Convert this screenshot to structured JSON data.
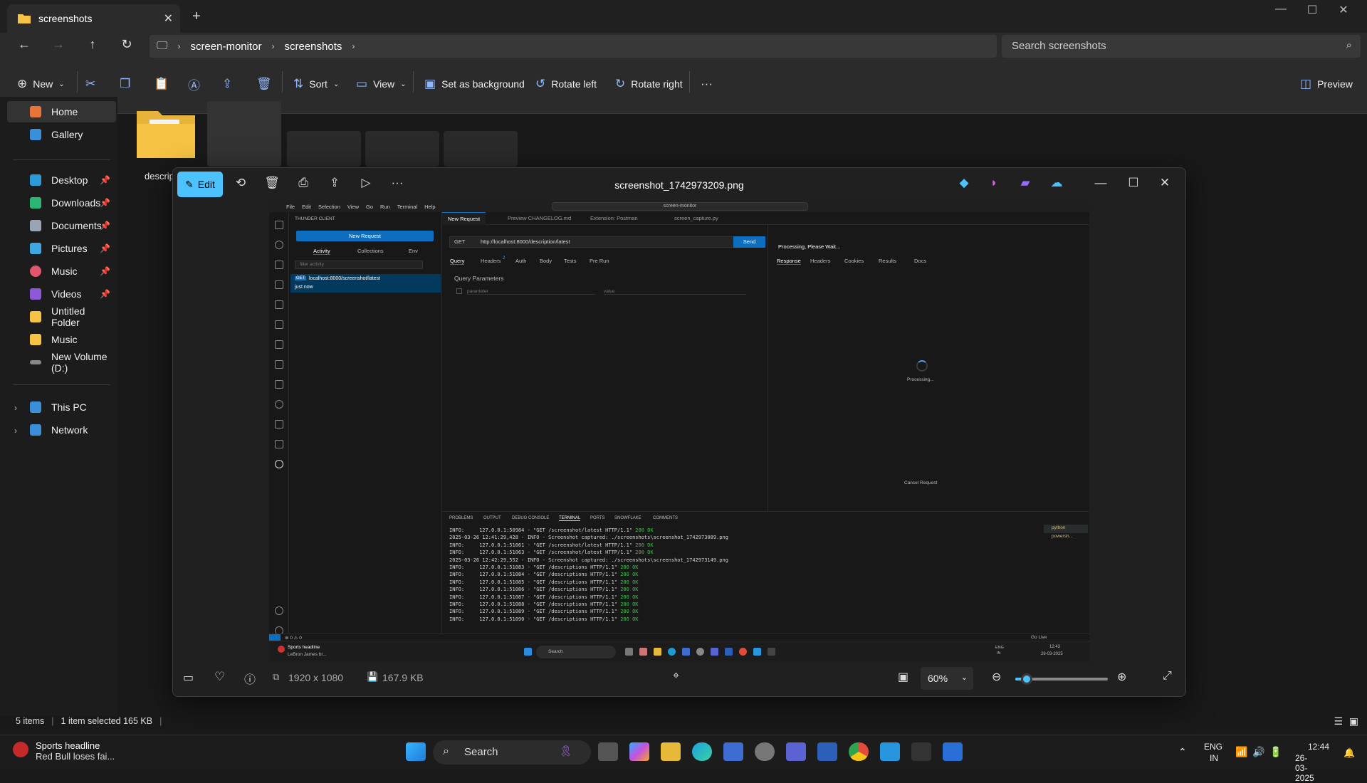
{
  "explorer": {
    "tab_title": "screenshots",
    "address": {
      "crumbs": [
        "screen-monitor",
        "screenshots"
      ]
    },
    "search_placeholder": "Search screenshots",
    "toolbar": {
      "new": "New",
      "sort": "Sort",
      "view": "View",
      "set_bg": "Set as background",
      "rotate_left": "Rotate left",
      "rotate_right": "Rotate right",
      "preview": "Preview"
    },
    "nav": {
      "home": "Home",
      "gallery": "Gallery",
      "desktop": "Desktop",
      "downloads": "Downloads",
      "documents": "Documents",
      "pictures": "Pictures",
      "music": "Music",
      "videos": "Videos",
      "untitled": "Untitled Folder",
      "music2": "Music",
      "volume": "New Volume (D:)",
      "thispc": "This PC",
      "network": "Network"
    },
    "folder_label": "descrip",
    "status": {
      "items": "5 items",
      "selected": "1 item selected  165 KB"
    }
  },
  "photos": {
    "edit": "Edit",
    "title": "screenshot_1742973209.png",
    "dimensions": "1920 x 1080",
    "filesize": "167.9 KB",
    "zoom": "60%",
    "zoom_fraction": 0.12
  },
  "inner": {
    "menu": [
      "File",
      "Edit",
      "Selection",
      "View",
      "Go",
      "Run",
      "Terminal",
      "Help"
    ],
    "command_center": "screen-monitor",
    "panel_title": "THUNDER CLIENT",
    "new_request": "New Request",
    "side_tabs": [
      "Activity",
      "Collections",
      "Env"
    ],
    "filter": "filter activity",
    "activity_method": "GET",
    "activity_url": "localhost:8000/screenshot/latest",
    "activity_time": "just now",
    "editor_tabs": [
      "New Request",
      "Preview CHANGELOG.md",
      "Extension: Postman",
      "screen_capture.py"
    ],
    "method": "GET",
    "url": "http://localhost:8000/description/latest",
    "send": "Send",
    "req_tabs": [
      "Query",
      "Headers",
      "Auth",
      "Body",
      "Tests",
      "Pre Run"
    ],
    "headers_count": "2",
    "query_params": "Query Parameters",
    "param_ph": "parameter",
    "value_ph": "value",
    "processing": "Processing, Please Wait...",
    "res_tabs": [
      "Response",
      "Headers",
      "Cookies",
      "Results",
      "Docs"
    ],
    "processing_small": "Processing...",
    "cancel": "Cancel Request",
    "term_tabs": [
      "PROBLEMS",
      "OUTPUT",
      "DEBUG CONSOLE",
      "TERMINAL",
      "PORTS",
      "SNOWFLAKE",
      "COMMENTS"
    ],
    "term_side": [
      "python",
      "powersh..."
    ],
    "term_lines": [
      {
        "a": "INFO:     127.0.0.1:50984 - \"GET /screenshot/latest HTTP/1.1\" ",
        "b": "200 OK"
      },
      {
        "a": "2025-03-26 12:41:29,428 - INFO - Screenshot captured: ./screenshots\\screenshot_1742973089.png",
        "b": ""
      },
      {
        "a": "INFO:     127.0.0.1:51061 - \"GET /screenshot/latest HTTP/1.1\" ",
        "b": "200 OK"
      },
      {
        "a": "INFO:     127.0.0.1:51063 - \"GET /screenshot/latest HTTP/1.1\" ",
        "b": "200 OK"
      },
      {
        "a": "2025-03-26 12:42:29,552 - INFO - Screenshot captured: ./screenshots\\screenshot_1742973149.png",
        "b": ""
      },
      {
        "a": "INFO:     127.0.0.1:51083 - \"GET /descriptions HTTP/1.1\" ",
        "b": "200 OK"
      },
      {
        "a": "INFO:     127.0.0.1:51084 - \"GET /descriptions HTTP/1.1\" ",
        "b": "200 OK"
      },
      {
        "a": "INFO:     127.0.0.1:51085 - \"GET /descriptions HTTP/1.1\" ",
        "b": "200 OK"
      },
      {
        "a": "INFO:     127.0.0.1:51086 - \"GET /descriptions HTTP/1.1\" ",
        "b": "200 OK"
      },
      {
        "a": "INFO:     127.0.0.1:51087 - \"GET /descriptions HTTP/1.1\" ",
        "b": "200 OK"
      },
      {
        "a": "INFO:     127.0.0.1:51088 - \"GET /descriptions HTTP/1.1\" ",
        "b": "200 OK"
      },
      {
        "a": "INFO:     127.0.0.1:51089 - \"GET /descriptions HTTP/1.1\" ",
        "b": "200 OK"
      },
      {
        "a": "INFO:     127.0.0.1:51090 - \"GET /descriptions HTTP/1.1\" ",
        "b": "200 OK"
      }
    ],
    "status_left": "⊗ 0 ⚠ 0",
    "go_live": "Go Live",
    "news_title": "Sports headline",
    "news_sub": "LeBron James br...",
    "task_search": "Search",
    "tray_lang": "ENG",
    "tray_region": "IN",
    "tray_time": "12:43",
    "tray_date": "26-03-2025"
  },
  "taskbar": {
    "news_title": "Sports headline",
    "news_sub": "Red Bull loses fai...",
    "search": "Search",
    "lang": "ENG",
    "region": "IN",
    "time": "12:44",
    "date": "26-03-2025"
  }
}
